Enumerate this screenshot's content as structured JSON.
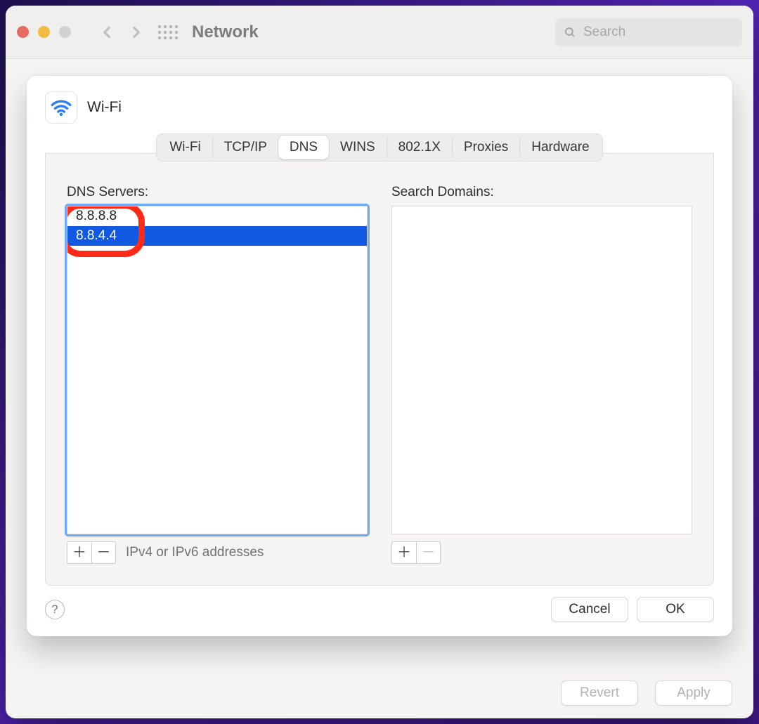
{
  "toolbar": {
    "title": "Network",
    "search_placeholder": "Search"
  },
  "sheet": {
    "title": "Wi-Fi",
    "tabs": [
      "Wi-Fi",
      "TCP/IP",
      "DNS",
      "WINS",
      "802.1X",
      "Proxies",
      "Hardware"
    ],
    "active_tab_index": 2,
    "dns": {
      "servers_label": "DNS Servers:",
      "servers": [
        "8.8.8.8",
        "8.8.4.4"
      ],
      "selected_index": 1,
      "hint": "IPv4 or IPv6 addresses"
    },
    "search_domains": {
      "label": "Search Domains:",
      "items": []
    },
    "buttons": {
      "cancel": "Cancel",
      "ok": "OK"
    }
  },
  "footer": {
    "revert": "Revert",
    "apply": "Apply"
  }
}
